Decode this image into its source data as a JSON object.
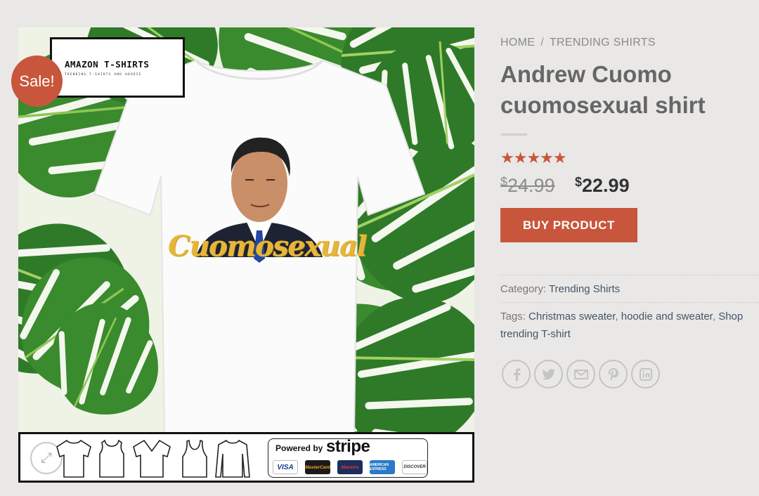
{
  "brand": {
    "name": "AMAZON T-SHIRTS",
    "tagline": "TRENDING T-SHIRTS AND HOODIE"
  },
  "badge": {
    "sale": "Sale!"
  },
  "shirt_print_text": "Cuomosexual",
  "payment": {
    "powered_by": "Powered by",
    "provider": "stripe",
    "cards": [
      "VISA",
      "MasterCard",
      "Maestro",
      "AMERICAN EXPRESS",
      "DISCOVER"
    ]
  },
  "breadcrumb": {
    "home": "HOME",
    "separator": "/",
    "category": "TRENDING SHIRTS"
  },
  "product": {
    "title": "Andrew Cuomo cuomosexual shirt",
    "rating_stars": 5,
    "currency": "$",
    "price_old": "24.99",
    "price_new": "22.99",
    "buy_label": "BUY PRODUCT"
  },
  "meta": {
    "category_label": "Category:",
    "category": "Trending Shirts",
    "tags_label": "Tags:",
    "tags": [
      "Christmas sweater",
      "hoodie and sweater",
      "Shop trending T-shirt"
    ]
  },
  "share": [
    "facebook-icon",
    "twitter-icon",
    "email-icon",
    "pinterest-icon",
    "linkedin-icon"
  ],
  "colors": {
    "accent": "#c8563c",
    "background": "#e9e8e6",
    "link": "#44556a",
    "print_yellow": "#e6b63a"
  }
}
